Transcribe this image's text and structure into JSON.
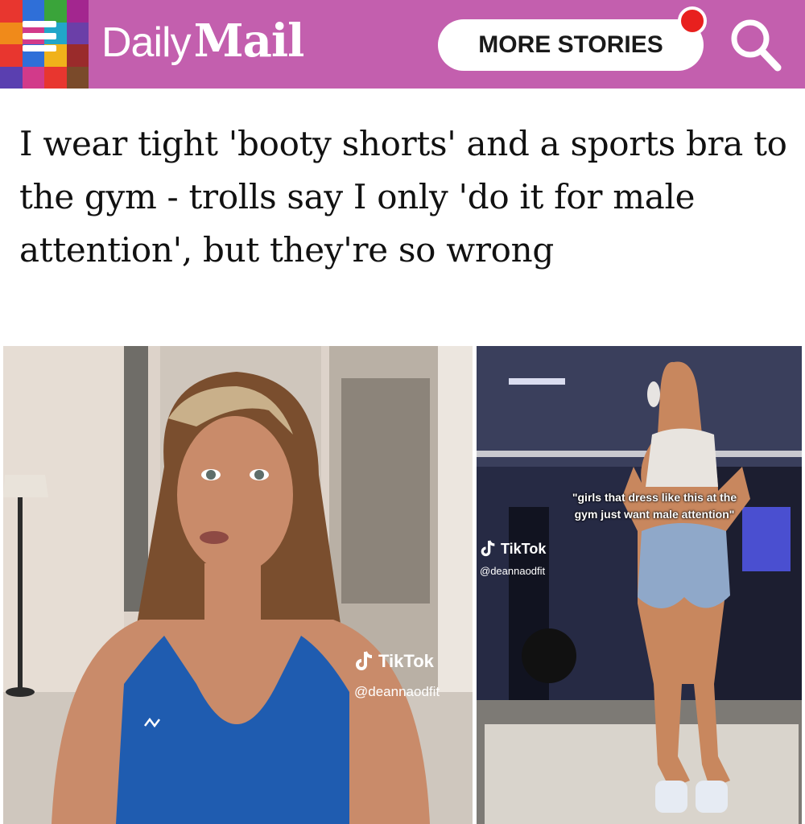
{
  "header": {
    "brand_daily": "Daily",
    "brand_mail": "Mail",
    "more_stories_label": "MORE STORIES",
    "background_color": "#c35fae",
    "icons": [
      "menu-icon",
      "search-icon",
      "notification-dot"
    ]
  },
  "article": {
    "headline": "I wear tight 'booty shorts' and a sports bra to the gym - trolls say I only 'do it for male attention', but they're so wrong"
  },
  "images": {
    "left": {
      "watermark_brand": "TikTok",
      "watermark_handle": "@deannaodfit"
    },
    "right": {
      "caption": "\"girls that dress like this at the gym just want male attention\"",
      "watermark_brand": "TikTok",
      "watermark_handle": "@deannaodfit"
    }
  }
}
